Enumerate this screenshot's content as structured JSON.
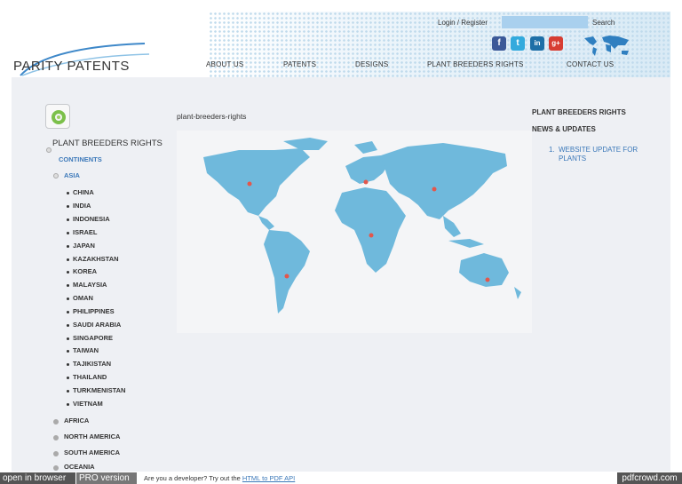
{
  "header": {
    "logo_text": "PARITY PATENTS",
    "login_label": "Login / Register",
    "search_label": "Search",
    "search_value": "",
    "social": [
      {
        "name": "facebook",
        "glyph": "f",
        "color": "#3b5998"
      },
      {
        "name": "twitter",
        "glyph": "t",
        "color": "#33aadd"
      },
      {
        "name": "linkedin",
        "glyph": "in",
        "color": "#1e6fa7"
      },
      {
        "name": "googleplus",
        "glyph": "g+",
        "color": "#d73d32"
      }
    ],
    "nav": [
      "ABOUT US",
      "PATENTS",
      "DESIGNS",
      "PLANT BREEDERS RIGHTS",
      "CONTACT US"
    ]
  },
  "breadcrumb": "plant-breeders-rights",
  "tree": {
    "title": "PLANT BREEDERS RIGHTS",
    "continents_label": "CONTINENTS",
    "asia_label": "ASIA",
    "asia_countries": [
      "CHINA",
      "INDIA",
      "INDONESIA",
      "ISRAEL",
      "JAPAN",
      "KAZAKHSTAN",
      "KOREA",
      "MALAYSIA",
      "OMAN",
      "PHILIPPINES",
      "SAUDI ARABIA",
      "SINGAPORE",
      "TAIWAN",
      "TAJIKISTAN",
      "THAILAND",
      "TURKMENISTAN",
      "VIETNAM"
    ],
    "other_regions": [
      "AFRICA",
      "NORTH AMERICA",
      "SOUTH AMERICA",
      "OCEANIA"
    ]
  },
  "sidebar": {
    "heading1": "PLANT BREEDERS RIGHTS",
    "heading2": "NEWS & UPDATES",
    "news_number": "1.",
    "news_item": "WEBSITE UPDATE FOR PLANTS"
  },
  "colors": {
    "map_land": "#6fb9dc",
    "accent": "#3b78b9",
    "button_dark": "#555555"
  },
  "footer": {
    "open_browser": "open in browser",
    "pro_version": "PRO version",
    "dev_text": "Are you a developer? Try out the",
    "api_link": "HTML to PDF API",
    "brand": "pdfcrowd.com"
  }
}
